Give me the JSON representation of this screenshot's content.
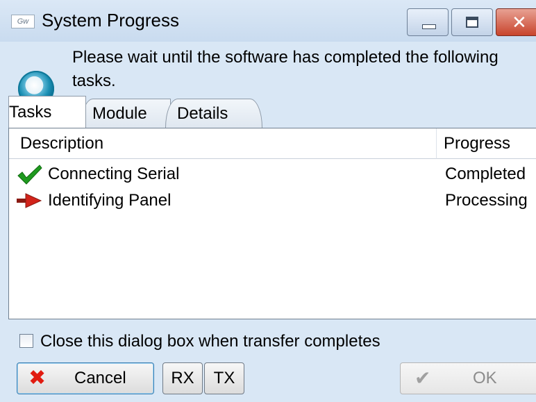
{
  "window": {
    "title": "System Progress",
    "app_icon_label": "Gw"
  },
  "header": {
    "message": "Please wait until the software has completed the following tasks."
  },
  "tabs": [
    {
      "label": "Tasks",
      "active": true
    },
    {
      "label": "Module",
      "active": false
    },
    {
      "label": "Details",
      "active": false
    }
  ],
  "table": {
    "columns": [
      "Description",
      "Progress"
    ],
    "rows": [
      {
        "icon": "green-check-icon",
        "description": "Connecting Serial",
        "progress": "Completed"
      },
      {
        "icon": "red-arrow-icon",
        "description": "Identifying Panel",
        "progress": "Processing"
      }
    ]
  },
  "options": {
    "close_on_complete_label": "Close this dialog box when transfer completes",
    "close_on_complete_checked": false
  },
  "buttons": {
    "cancel": "Cancel",
    "rx": "RX",
    "tx": "TX",
    "ok": "OK"
  },
  "colors": {
    "completed_check": "#1f9a1f",
    "processing_arrow": "#d2231a",
    "cancel_x": "#e11b10"
  }
}
